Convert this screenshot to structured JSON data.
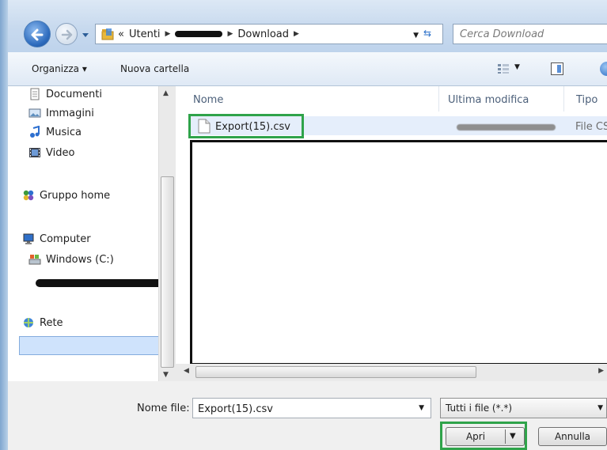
{
  "address_bar": {
    "crumbs": [
      "Utenti",
      "Download"
    ],
    "overflow_marker": "«"
  },
  "search": {
    "placeholder": "Cerca Download"
  },
  "toolbar": {
    "organize_label": "Organizza ▾",
    "new_folder_label": "Nuova cartella"
  },
  "nav_pane": {
    "items": [
      {
        "label": "Documenti",
        "icon": "document-icon"
      },
      {
        "label": "Immagini",
        "icon": "pictures-icon"
      },
      {
        "label": "Musica",
        "icon": "music-icon"
      },
      {
        "label": "Video",
        "icon": "video-icon"
      },
      {
        "label": "Gruppo home",
        "icon": "homegroup-icon"
      },
      {
        "label": "Computer",
        "icon": "computer-icon"
      },
      {
        "label": "Windows (C:)",
        "icon": "drive-icon"
      },
      {
        "label": "Rete",
        "icon": "network-icon"
      }
    ],
    "selected": "Windows (C:)"
  },
  "file_list": {
    "columns": [
      "Nome",
      "Ultima modifica",
      "Tipo"
    ],
    "rows": [
      {
        "name": "Export(15).csv",
        "type": "File CS"
      }
    ]
  },
  "footer": {
    "filename_label": "Nome file:",
    "filename_value": "Export(15).csv",
    "filter_value": "Tutti i file (*.*)",
    "open_label": "Apri",
    "cancel_label": "Annulla"
  },
  "colors": {
    "highlight_green": "#2fa34a",
    "selection_blue": "#cfe3fc"
  }
}
